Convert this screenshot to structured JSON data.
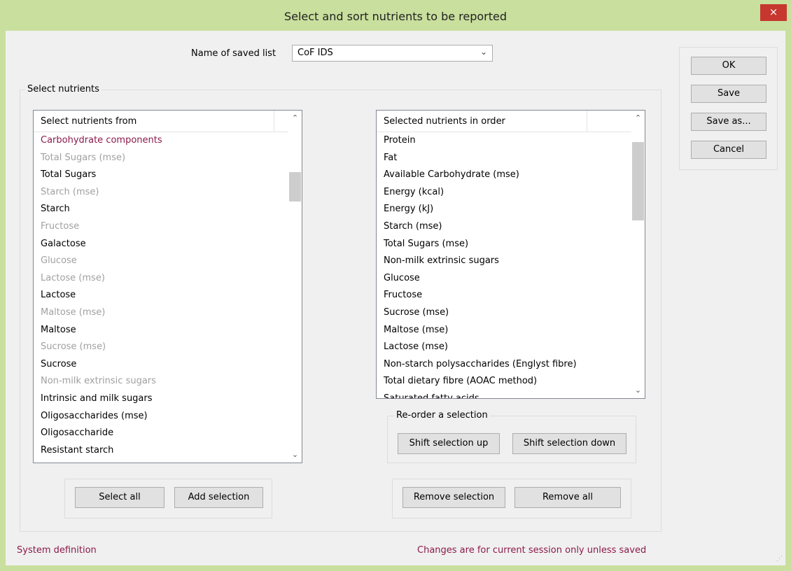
{
  "window": {
    "title": "Select and sort nutrients to be reported",
    "close_glyph": "×"
  },
  "saved_list": {
    "label": "Name of saved list",
    "value": "CoF IDS"
  },
  "side_buttons": {
    "ok": "OK",
    "save": "Save",
    "save_as": "Save as...",
    "cancel": "Cancel"
  },
  "select_group": {
    "title": "Select nutrients"
  },
  "source_list": {
    "header": "Select nutrients from",
    "items": [
      {
        "label": "Carbohydrate components",
        "style": "group"
      },
      {
        "label": "Total Sugars (mse)",
        "style": "muted"
      },
      {
        "label": "Total Sugars",
        "style": "normal"
      },
      {
        "label": "Starch (mse)",
        "style": "muted"
      },
      {
        "label": "Starch",
        "style": "normal"
      },
      {
        "label": "Fructose",
        "style": "muted"
      },
      {
        "label": "Galactose",
        "style": "normal"
      },
      {
        "label": "Glucose",
        "style": "muted"
      },
      {
        "label": "Lactose (mse)",
        "style": "muted"
      },
      {
        "label": "Lactose",
        "style": "normal"
      },
      {
        "label": "Maltose (mse)",
        "style": "muted"
      },
      {
        "label": "Maltose",
        "style": "normal"
      },
      {
        "label": "Sucrose (mse)",
        "style": "muted"
      },
      {
        "label": "Sucrose",
        "style": "normal"
      },
      {
        "label": "Non-milk extrinsic sugars",
        "style": "muted"
      },
      {
        "label": "Intrinsic and milk sugars",
        "style": "normal"
      },
      {
        "label": "Oligosaccharides (mse)",
        "style": "normal"
      },
      {
        "label": "Oligosaccharide",
        "style": "normal"
      },
      {
        "label": "Resistant starch",
        "style": "normal"
      }
    ]
  },
  "selected_list": {
    "header": "Selected nutrients in order",
    "items": [
      "Protein",
      "Fat",
      "Available Carbohydrate (mse)",
      "Energy (kcal)",
      "Energy (kJ)",
      "Starch (mse)",
      "Total Sugars (mse)",
      "Non-milk extrinsic sugars",
      "Glucose",
      "Fructose",
      "Sucrose (mse)",
      "Maltose (mse)",
      "Lactose (mse)",
      "Non-starch polysaccharides (Englyst fibre)",
      "Total dietary fibre (AOAC method)",
      "Saturated fatty acids"
    ]
  },
  "reorder": {
    "title": "Re-order a selection",
    "up": "Shift selection up",
    "down": "Shift selection down"
  },
  "add_buttons": {
    "select_all": "Select all",
    "add_selection": "Add selection"
  },
  "remove_buttons": {
    "remove_selection": "Remove selection",
    "remove_all": "Remove all"
  },
  "footer": {
    "left": "System definition",
    "right": "Changes are for current session only unless saved"
  },
  "icons": {
    "close": "close-icon",
    "dropdown": "chevron-down-icon",
    "scroll_up": "chevron-up-icon",
    "scroll_down": "chevron-down-icon",
    "resize": "resize-grip-icon"
  },
  "colors": {
    "title_bar": "#c9df9d",
    "close_button": "#c7372f",
    "accent_text": "#8b1a4a",
    "muted_text": "#a0a0a0"
  }
}
